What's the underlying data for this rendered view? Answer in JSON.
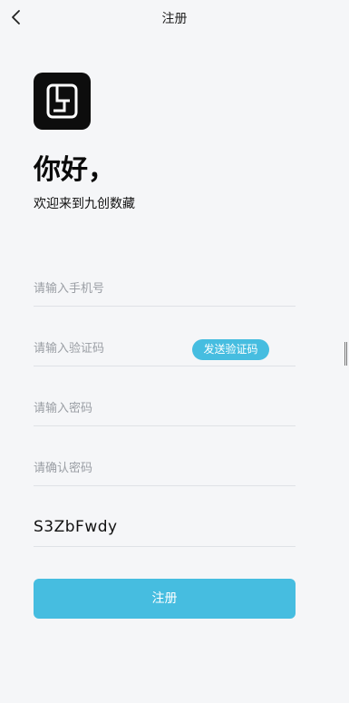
{
  "header": {
    "title": "注册",
    "back_icon": "chevron-left-icon"
  },
  "brand": {
    "logo_icon": "app-logo",
    "logo_bg": "#0d0d0d"
  },
  "intro": {
    "greeting": "你好，",
    "welcome": "欢迎来到九创数藏"
  },
  "form": {
    "phone_placeholder": "请输入手机号",
    "code_placeholder": "请输入验证码",
    "send_code_label": "发送验证码",
    "password_placeholder": "请输入密码",
    "confirm_placeholder": "请确认密码",
    "captcha_text": "S3ZbFwdy",
    "submit_label": "注册"
  },
  "colors": {
    "accent": "#46bde0",
    "background": "#f5f6f8"
  }
}
